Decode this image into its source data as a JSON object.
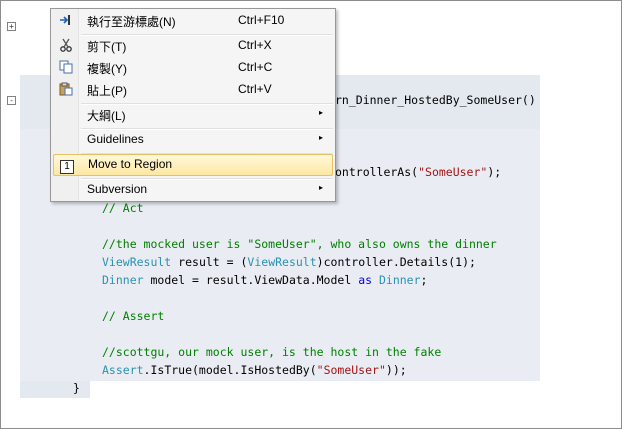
{
  "code": {
    "method_sig_tail": "rn_Dinner_HostedBy_SomeUser()",
    "controller_as_pre": "ontrollerAs(",
    "controller_as_str": "\"SomeUser\"",
    "controller_as_post": ");",
    "act_comment": "// Act",
    "mock_comment": "//the mocked user is \"SomeUser\", who also owns the dinner",
    "viewresult_type": "ViewResult",
    "viewresult_mid": " result = (",
    "viewresult_cast": "ViewResult",
    "viewresult_post": ")controller.Details(1);",
    "dinner_type": "Dinner",
    "dinner_mid": " model = result.ViewData.Model ",
    "dinner_as": "as",
    "dinner_space": " ",
    "dinner_type2": "Dinner",
    "dinner_post": ";",
    "assert_comment": "// Assert",
    "scottgu_comment": "//scottgu, our mock user, is the host in the fake",
    "assert_type": "Assert",
    "assert_mid": ".IsTrue(model.IsHostedBy(",
    "assert_str": "\"SomeUser\"",
    "assert_post": "));",
    "closing_brace": "}"
  },
  "gutter": {
    "fold1": "+",
    "fold2": "-"
  },
  "menu": {
    "items": [
      {
        "label": "執行至游標處(N)",
        "shortcut": "Ctrl+F10",
        "icon": "run-to-cursor-icon"
      },
      {
        "label": "剪下(T)",
        "shortcut": "Ctrl+X",
        "icon": "scissors-icon"
      },
      {
        "label": "複製(Y)",
        "shortcut": "Ctrl+C",
        "icon": "copy-icon"
      },
      {
        "label": "貼上(P)",
        "shortcut": "Ctrl+V",
        "icon": "paste-icon"
      },
      {
        "label": "大綱(L)",
        "shortcut": "",
        "icon": ""
      },
      {
        "label": "Guidelines",
        "shortcut": "",
        "icon": ""
      },
      {
        "label": "Move to Region",
        "shortcut": "",
        "icon": "move-to-region-icon",
        "icon_text": "1"
      },
      {
        "label": "Subversion",
        "shortcut": "",
        "icon": ""
      }
    ],
    "arrow": "▸"
  }
}
